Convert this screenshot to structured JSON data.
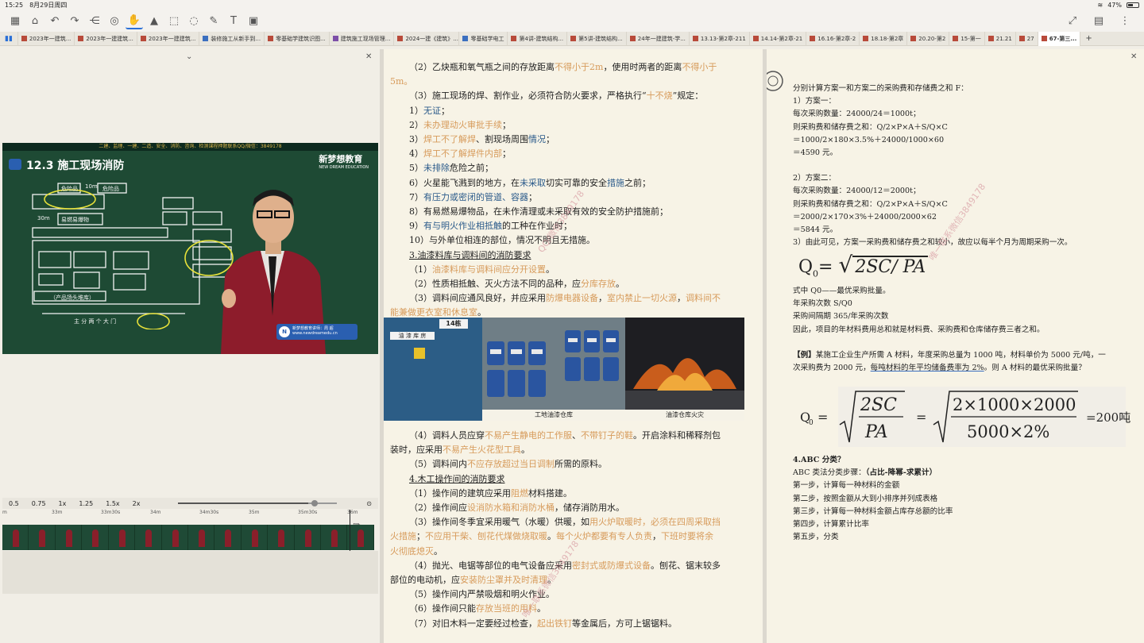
{
  "status": {
    "time": "15:25",
    "date": "8月29日周四",
    "battery": "47%"
  },
  "tabs": [
    {
      "label": "2023年一建筑...",
      "color": "red"
    },
    {
      "label": "2023年一建建筑...",
      "color": "red"
    },
    {
      "label": "2023年一建建筑...",
      "color": "red"
    },
    {
      "label": "装修施工从新手到...",
      "color": "blue"
    },
    {
      "label": "零基础学建筑识图...",
      "color": "red"
    },
    {
      "label": "建筑施工现场管理...",
      "color": "purple"
    },
    {
      "label": "2024一建《建筑》...",
      "color": "red"
    },
    {
      "label": "零基础学电工",
      "color": "blue"
    },
    {
      "label": "第4讲-建筑结构...",
      "color": "red"
    },
    {
      "label": "第5讲-建筑结构...",
      "color": "red"
    },
    {
      "label": "24年一建建筑-学...",
      "color": "red"
    },
    {
      "label": "13.13-第2章-211",
      "color": "red"
    },
    {
      "label": "14.14-第2章-21",
      "color": "red"
    },
    {
      "label": "16.16-第2章-2",
      "color": "red"
    },
    {
      "label": "18.18-第2章",
      "color": "red"
    },
    {
      "label": "20.20-第2",
      "color": "red"
    },
    {
      "label": "15-第一",
      "color": "red"
    },
    {
      "label": "21.21",
      "color": "red"
    },
    {
      "label": "27",
      "color": "red"
    },
    {
      "label": "67-第三...",
      "color": "red",
      "active": true
    }
  ],
  "video": {
    "top_strip": "二建、监理、一建、二造、安全、消防、咨询、检测课程押题联系QQ/微信：3849178",
    "heading": "12.3  施工现场消防",
    "logo": "新梦想教育",
    "logo_sub": "NEW DREAM EDUCATION",
    "caption_title": "新梦想教育讲师：周 超",
    "caption_url": "www.newdreamedu.cn",
    "board": {
      "top_label_1": "危险品",
      "top_label_2": "危险品",
      "d1": "10m",
      "d2": "30m",
      "warehouse": "易燃易爆物",
      "bottom": "（产品场头堆库）",
      "gate": "主 分 两 个 大 门"
    }
  },
  "speeds": [
    "0.5",
    "0.75",
    "1x",
    "1.25",
    "1.5x",
    "2x"
  ],
  "speed_fraction": 0.82,
  "timeline_labels": [
    "m",
    "33m",
    "33m30s",
    "34m",
    "34m30s",
    "35m",
    "35m30s",
    "36m"
  ],
  "doc2": {
    "l1a": "（2）乙炔瓶和氧气瓶之间的存放距离",
    "l1b": "不得小于2m",
    "l1c": "，使用时两者的距离",
    "l1d": "不得小于",
    "l2": "5m。",
    "l3a": "（3）施工现场的焊、割作业，必须符合防火要求，严格执行“",
    "l3b": "十不烧",
    "l3c": "”规定：",
    "i1a": "1）",
    "i1b": "无证",
    "i1c": "；",
    "i2a": "2）",
    "i2b": "未办理动火审批手续",
    "i2c": "；",
    "i3a": "3）",
    "i3b": "焊工不了解焊",
    "i3c": "、割现场周围",
    "i3d": "情况",
    "i3e": "；",
    "i4a": "4）",
    "i4b": "焊工不了解焊件内部",
    "i4c": "；",
    "i5a": "5）",
    "i5b": "未排除",
    "i5c": "危险之前；",
    "i6a": "6）火星能飞溅到的地方，在",
    "i6b": "未采取",
    "i6c": "切实可靠的安全",
    "i6d": "措施",
    "i6e": "之前；",
    "i7a": "7）",
    "i7b": "有压力或密闭的管道、容器",
    "i7c": "；",
    "i8": "8）有易燃易爆物品，在未作清理或未采取有效的安全防护措施前；",
    "i9a": "9）",
    "i9b": "有与明火作业相抵触",
    "i9c": "的工种在作业时；",
    "i10": "10）与外单位相连的部位，情况不明且无措施。",
    "h3": "3.油漆料库与调料间的消防要求",
    "p1a": "（1）",
    "p1b": "油漆料库与调料间应分开设置",
    "p1c": "。",
    "p2a": "（2）性质相抵触、灭火方法不同的品种，应",
    "p2b": "分库存放",
    "p2c": "。",
    "p3a": "（3）调料间应通风良好，并应采用",
    "p3b": "防爆电器设备",
    "p3c": "，",
    "p3d": "室内禁止一切火源",
    "p3e": "，",
    "p3f": "调料间不",
    "p3g": "能兼做更衣室和休息室",
    "p3h": "。"
  },
  "photos": {
    "cap1": "工地油漆仓库",
    "cap2": "油漆仓库火灾",
    "sign": "油 漆 库 房",
    "num": "14栋"
  },
  "doc2b": {
    "p4a": "（4）调料人员应穿",
    "p4b": "不易产生静电的工作服",
    "p4c": "、",
    "p4d": "不带钉子的鞋",
    "p4e": "。开启涂料和稀释剂包",
    "p4f": "装时，应采用",
    "p4g": "不易产生火花型工具",
    "p4h": "。",
    "p5a": "（5）调料间内",
    "p5b": "不应存放超过当日调制",
    "p5c": "所需的原料。",
    "h4": "4.木工操作间的消防要求",
    "w1a": "（1）操作间的建筑应采用",
    "w1b": "阻燃",
    "w1c": "材料搭建。",
    "w2a": "（2）操作间应",
    "w2b": "设消防水箱和消防水桶",
    "w2c": "，储存消防用水。",
    "w3a": "（3）操作间冬季宜采用暖气（水暖）供暖，如",
    "w3b": "用火炉取暖时，必须在四周采取挡",
    "w3c": "火措施",
    "w3d": "；",
    "w3e": "不应用干柴、刨花代煤做烧取暖",
    "w3f": "。",
    "w3g": "每个火炉都要有专人负责",
    "w3h": "，",
    "w3i": "下班时要将余",
    "w3j": "火彻底熄灭",
    "w3k": "。",
    "w4a": "（4）抛光、电锯等部位的电气设备应采用",
    "w4b": "密封式或防爆式设备",
    "w4c": "。刨花、锯末较多",
    "w4d": "部位的电动机，应",
    "w4e": "安装防尘罩并及时清理",
    "w4f": "。",
    "w5": "（5）操作间内严禁吸烟和明火作业。",
    "w6a": "（6）操作间只能",
    "w6b": "存放当班的用料",
    "w6c": "。",
    "w7a": "（7）对旧木料一定要经过检查，",
    "w7b": "起出铁钉",
    "w7c": "等金属后，方可上锯锯料。"
  },
  "watermarks": [
    "QQ/微信3849178",
    "唯一联系微信3849178",
    "唯一联系微信3849178"
  ],
  "doc3": {
    "l1": "分别计算方案一和方案二的采购费和存储费之和 F：",
    "l2": "1）方案一：",
    "l3": "每次采购数量：24000/24＝1000t；",
    "l4": "则采购费和储存费之和：Q/2×P×A＋S/Q×C",
    "l5": "＝1000/2×180×3.5%＋24000/1000×60",
    "l6": "＝4590 元。",
    "l7": "",
    "l8": "2）方案二：",
    "l9": "每次采购数量：24000/12＝2000t；",
    "l10": "则采购费和储存费之和：Q/2×P×A＋S/Q×C",
    "l11": "＝2000/2×170×3%＋24000/2000×62",
    "l12": "＝5844 元。",
    "l13": "3）由此可见，方案一采购费和储存费之和较小，故应以每半个月为周期采购一次。"
  },
  "formula1": {
    "lhs": "Q",
    "sub": "0",
    "eq": "=",
    "rad": "2SC/ PA"
  },
  "doc3b": {
    "l1": "式中 Q0——最优采购批量。",
    "l2": "年采购次数 S/Q0",
    "l3": "采购间隔期 365/年采购次数",
    "l4": "因此，项目的年材料费用总和就是材料费、采购费和仓库储存费三者之和。",
    "l5": "",
    "e1a": "【例】",
    "e1b": "某施工企业生产所需 A 材料，年度采购总量为 1000 吨，材料单价为 5000 元/吨，一",
    "e2a": "次采购费为 2000 元，",
    "e2b": "每吨材料的年平均储备费率为 2%",
    "e2c": "。则 A 材料的最优采购批量？"
  },
  "formula2": {
    "lhs": "Q",
    "sub": "0",
    "eq": "=",
    "n1": "2SC",
    "d1": "PA",
    "eq2": "=",
    "n2": "2×1000×2000",
    "d2": "5000×2%",
    "result": "=200吨"
  },
  "doc3c": {
    "h": "4.ABC 分类？",
    "l1a": "ABC 类法分类步骤：",
    "l1b": "（占比-降幂-求累计）",
    "s1": "第一步，计算每一种材料的金额",
    "s2": "第二步，按照金额从大到小排序并列成表格",
    "s3": "第三步，计算每一种材料金额占库存总额的比率",
    "s4": "第四步，计算累计比率",
    "s5": "第五步，分类"
  }
}
